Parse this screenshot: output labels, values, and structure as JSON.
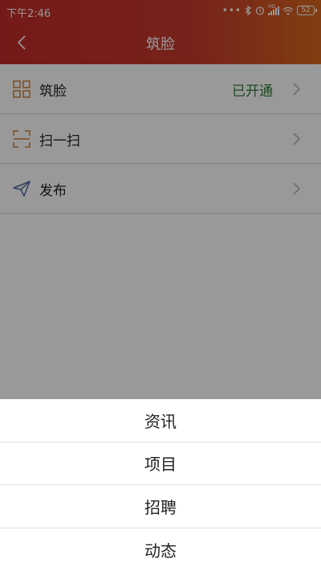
{
  "status_bar": {
    "time": "下午2:46",
    "hd_label": "HD",
    "battery": "52"
  },
  "toolbar": {
    "title": "筑脸"
  },
  "list": {
    "items": [
      {
        "label": "筑脸",
        "status": "已开通",
        "icon": "grid-icon"
      },
      {
        "label": "扫一扫",
        "icon": "scan-icon"
      },
      {
        "label": "发布",
        "icon": "paper-plane-icon"
      }
    ]
  },
  "action_sheet": {
    "options": [
      "资讯",
      "项目",
      "招聘",
      "动态"
    ]
  },
  "colors": {
    "header_start": "#c22b2b",
    "header_end": "#d8661e",
    "status_green": "#2e7d32",
    "icon_orange": "#c9823a",
    "icon_blue": "#4a6a9a"
  }
}
